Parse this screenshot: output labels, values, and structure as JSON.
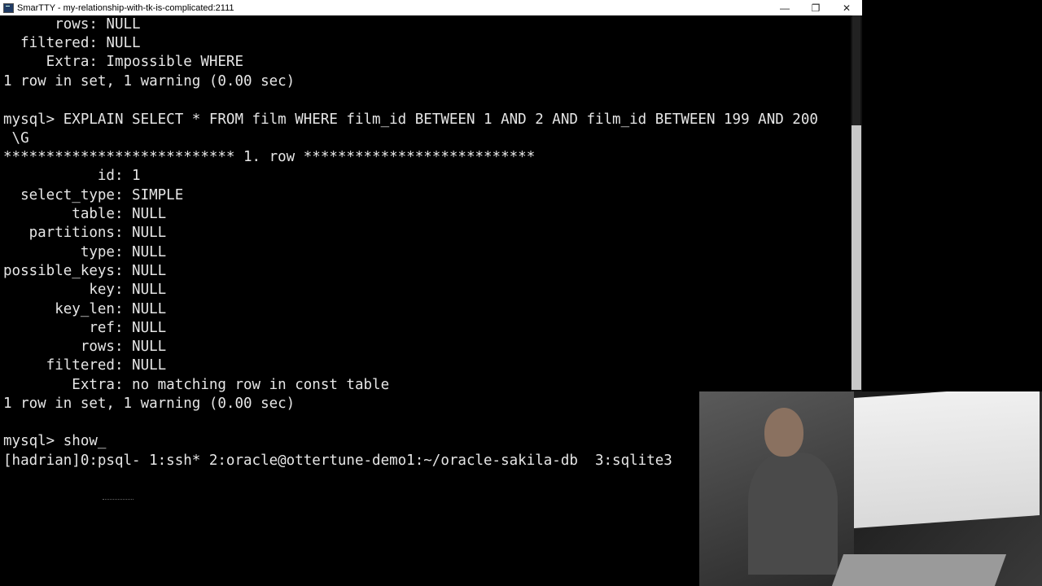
{
  "window": {
    "title": "SmarTTY - my-relationship-with-tk-is-complicated:2111",
    "controls": {
      "minimize": "—",
      "maximize": "❐",
      "close": "✕"
    }
  },
  "terminal": {
    "lines": [
      "      rows: NULL",
      "  filtered: NULL",
      "     Extra: Impossible WHERE",
      "1 row in set, 1 warning (0.00 sec)",
      "",
      "mysql> EXPLAIN SELECT * FROM film WHERE film_id BETWEEN 1 AND 2 AND film_id BETWEEN 199 AND 200",
      " \\G",
      "*************************** 1. row ***************************",
      "           id: 1",
      "  select_type: SIMPLE",
      "        table: NULL",
      "   partitions: NULL",
      "         type: NULL",
      "possible_keys: NULL",
      "          key: NULL",
      "      key_len: NULL",
      "          ref: NULL",
      "         rows: NULL",
      "     filtered: NULL",
      "        Extra: no matching row in const table",
      "1 row in set, 1 warning (0.00 sec)",
      "",
      "mysql> show_"
    ],
    "tmux_status": "[hadrian]0:psql- 1:ssh* 2:oracle@ottertune-demo1:~/oracle-sakila-db  3:sqlite3"
  },
  "webcam": {
    "label": "presenter-webcam"
  }
}
